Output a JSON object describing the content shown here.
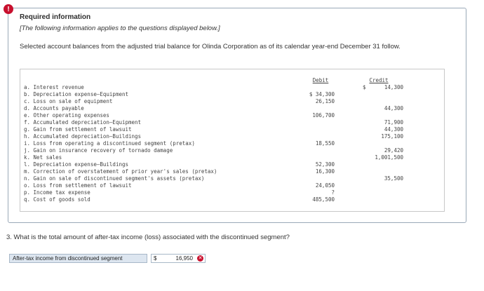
{
  "header": {
    "alert_icon": "!",
    "title": "Required information",
    "subtitle": "[The following information applies to the questions displayed below.]",
    "intro": "Selected account balances from the adjusted trial balance for Olinda Corporation as of its calendar year-end December 31 follow."
  },
  "table": {
    "debit_header": "Debit",
    "credit_header": "Credit",
    "rows": [
      {
        "label": "a. Interest revenue",
        "debit": "",
        "credit": "14,300",
        "credit_currency": "$"
      },
      {
        "label": "b. Depreciation expense—Equipment",
        "debit": "$ 34,300",
        "credit": ""
      },
      {
        "label": "c. Loss on sale of equipment",
        "debit": "26,150",
        "credit": ""
      },
      {
        "label": "d. Accounts payable",
        "debit": "",
        "credit": "44,300"
      },
      {
        "label": "e. Other operating expenses",
        "debit": "106,700",
        "credit": ""
      },
      {
        "label": "f. Accumulated depreciation—Equipment",
        "debit": "",
        "credit": "71,900"
      },
      {
        "label": "g. Gain from settlement of lawsuit",
        "debit": "",
        "credit": "44,300"
      },
      {
        "label": "h. Accumulated depreciation—Buildings",
        "debit": "",
        "credit": "175,100"
      },
      {
        "label": "i. Loss from operating a discontinued segment (pretax)",
        "debit": "18,550",
        "credit": ""
      },
      {
        "label": "j. Gain on insurance recovery of tornado damage",
        "debit": "",
        "credit": "29,420"
      },
      {
        "label": "k. Net sales",
        "debit": "",
        "credit": "1,001,500"
      },
      {
        "label": "l. Depreciation expense—Buildings",
        "debit": "52,300",
        "credit": ""
      },
      {
        "label": "m. Correction of overstatement of prior year's sales (pretax)",
        "debit": "16,300",
        "credit": ""
      },
      {
        "label": "n. Gain on sale of discontinued segment's assets (pretax)",
        "debit": "",
        "credit": "35,500"
      },
      {
        "label": "o. Loss from settlement of lawsuit",
        "debit": "24,050",
        "credit": ""
      },
      {
        "label": "p. Income tax expense",
        "debit": "?",
        "credit": ""
      },
      {
        "label": "q. Cost of goods sold",
        "debit": "485,500",
        "credit": ""
      }
    ]
  },
  "question": {
    "text": "3. What is the total amount of after-tax income (loss) associated with the discontinued segment?",
    "answer_label": "After-tax income from discontinued segment",
    "currency": "$",
    "answer_value": "16,950",
    "status_icon": "wrong-icon"
  }
}
